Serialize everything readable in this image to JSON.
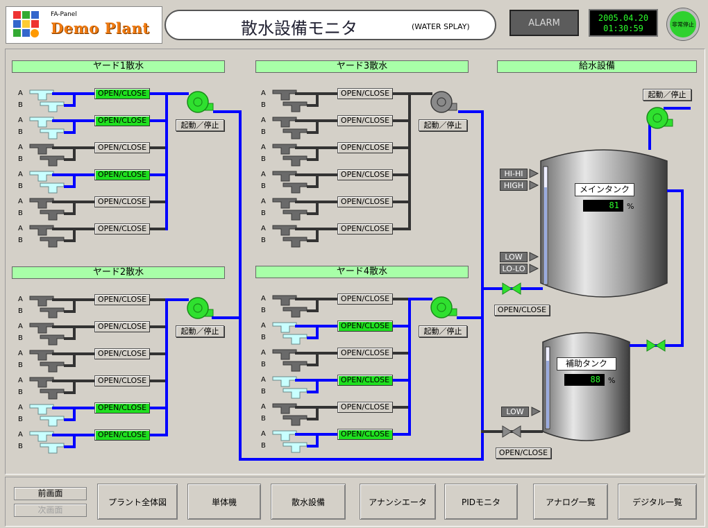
{
  "header": {
    "brand_small": "FA-Panel",
    "brand_big": "Demo Plant",
    "title": "散水設備モニタ",
    "subtitle": "(WATER SPLAY)",
    "alarm_label": "ALARM",
    "date": "2005.04.20",
    "time": "01:30:59",
    "estop_label": "非常停止"
  },
  "sections": {
    "yard1": "ヤード1散水",
    "yard2": "ヤード2散水",
    "yard3": "ヤード3散水",
    "yard4": "ヤード4散水",
    "supply": "給水設備"
  },
  "valve_label": "OPEN/CLOSE",
  "pump_label": "起動／停止",
  "ab_labels": {
    "a": "A",
    "b": "B"
  },
  "yards": {
    "yard1": {
      "pump_running": true,
      "rows": [
        true,
        true,
        false,
        true,
        false,
        false
      ]
    },
    "yard2": {
      "pump_running": true,
      "rows": [
        false,
        false,
        false,
        false,
        true,
        true
      ]
    },
    "yard3": {
      "pump_running": false,
      "rows": [
        false,
        false,
        false,
        false,
        false,
        false
      ]
    },
    "yard4": {
      "pump_running": true,
      "rows": [
        false,
        true,
        false,
        true,
        false,
        true
      ]
    }
  },
  "main_tank": {
    "name": "メインタンク",
    "level": "81",
    "unit": "%",
    "tags": [
      "HI-HI",
      "HIGH",
      "LOW",
      "LO-LO"
    ]
  },
  "aux_tank": {
    "name": "補助タンク",
    "level": "88",
    "unit": "%",
    "tags": [
      "LOW"
    ]
  },
  "colors": {
    "active": "#0000ff",
    "idle": "#333333",
    "on": "#1fe01f",
    "panel": "#d4d0c8"
  },
  "footer": {
    "prev": "前画面",
    "next": "次画面",
    "buttons": [
      "プラント全体図",
      "単体機",
      "散水設備",
      "アナンシエータ",
      "PIDモニタ",
      "アナログ一覧",
      "デジタル一覧"
    ]
  }
}
